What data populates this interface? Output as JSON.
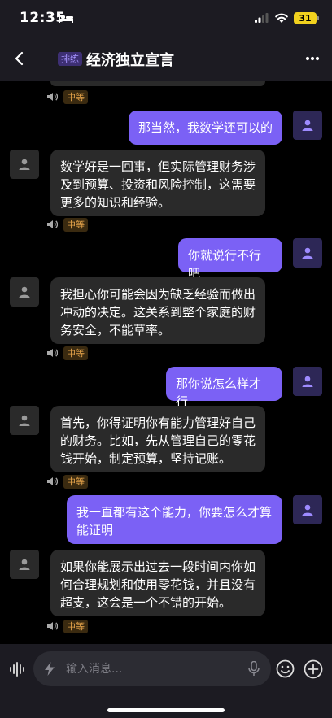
{
  "status_bar": {
    "time": "12:35",
    "battery": "31"
  },
  "header": {
    "tag": "排练",
    "title": "经济独立宣言"
  },
  "messages": [
    {
      "role": "user",
      "text": "那当然，我数学还可以的"
    },
    {
      "role": "bot",
      "text": "数学好是一回事，但实际管理财务涉及到预算、投资和风险控制，这需要更多的知识和经验。",
      "level": "中等"
    },
    {
      "role": "user",
      "text": "你就说行不行吧"
    },
    {
      "role": "bot",
      "text": "我担心你可能会因为缺乏经验而做出冲动的决定。这关系到整个家庭的财务安全，不能草率。",
      "level": "中等"
    },
    {
      "role": "user",
      "text": "那你说怎么样才行"
    },
    {
      "role": "bot",
      "text": "首先，你得证明你有能力管理好自己的财务。比如，先从管理自己的零花钱开始，制定预算，坚持记账。",
      "level": "中等"
    },
    {
      "role": "user",
      "text": "我一直都有这个能力，你要怎么才算能证明"
    },
    {
      "role": "bot",
      "text": "如果你能展示出过去一段时间内你如何合理规划和使用零花钱，并且没有超支，这会是一个不错的开始。",
      "level": "中等"
    }
  ],
  "top_partial_level": "中等",
  "input": {
    "placeholder": "输入消息..."
  },
  "colors": {
    "user_bubble": "#7b61f5",
    "bot_bubble": "#2a2a2a",
    "level_tag_text": "#e3a24a"
  }
}
